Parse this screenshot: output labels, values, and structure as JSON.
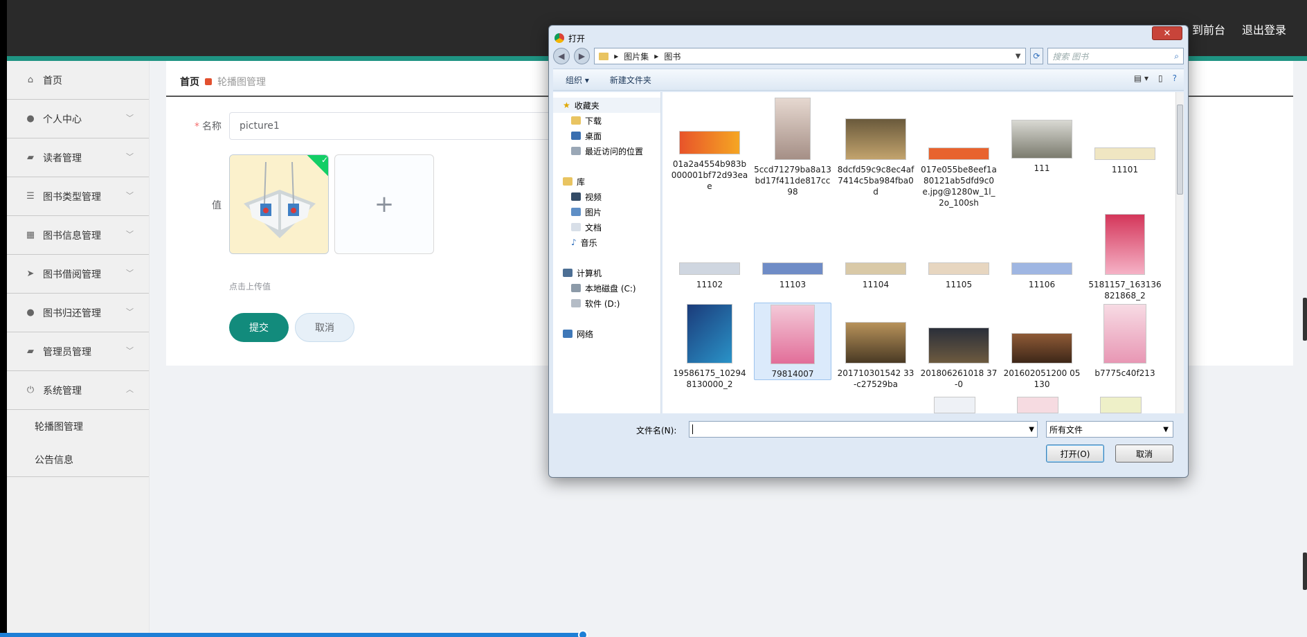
{
  "header": {
    "to_frontend": "到前台",
    "logout": "退出登录"
  },
  "sidebar": {
    "items": [
      {
        "label": "首页",
        "icon": "home-icon"
      },
      {
        "label": "个人中心",
        "icon": "user-icon"
      },
      {
        "label": "读者管理",
        "icon": "briefcase-icon"
      },
      {
        "label": "图书类型管理",
        "icon": "sliders-icon"
      },
      {
        "label": "图书信息管理",
        "icon": "grid-icon"
      },
      {
        "label": "图书借阅管理",
        "icon": "send-icon"
      },
      {
        "label": "图书归还管理",
        "icon": "user-icon"
      },
      {
        "label": "管理员管理",
        "icon": "briefcase-icon"
      },
      {
        "label": "系统管理",
        "icon": "power-icon"
      }
    ],
    "sub_items": [
      "轮播图管理",
      "公告信息"
    ]
  },
  "breadcrumb": {
    "home": "首页",
    "current": "轮播图管理"
  },
  "form": {
    "name_label": "名称",
    "name_value": "picture1",
    "value_label": "值",
    "upload_hint": "点击上传值",
    "submit": "提交",
    "cancel": "取消"
  },
  "dialog": {
    "title": "打开",
    "path": [
      "图片集",
      "图书"
    ],
    "search_placeholder": "搜索 图书",
    "toolbar": {
      "organize": "组织 ▾",
      "new_folder": "新建文件夹"
    },
    "nav": {
      "favorites": "收藏夹",
      "downloads": "下载",
      "desktop": "桌面",
      "recent": "最近访问的位置",
      "library": "库",
      "videos": "视频",
      "pictures": "图片",
      "documents": "文档",
      "music": "音乐",
      "computer": "计算机",
      "disk_c": "本地磁盘 (C:)",
      "disk_d": "软件 (D:)",
      "network": "网络"
    },
    "files": [
      "01a2a4554b983b000001bf72d93eae",
      "5ccd71279ba8a13bd17f411de817cc98",
      "8dcfd59c9c8ec4af7414c5ba984fba0d",
      "017e055be8eef1a80121ab5dfd9c0e.jpg@1280w_1l_2o_100sh",
      "111",
      "11101",
      "11102",
      "11103",
      "11104",
      "11105",
      "11106",
      "5181157_163136821868_2",
      "19586175_102948130000_2",
      "79814007",
      "201710301542 33-c27529ba",
      "201806261018 37-0",
      "201602051200 05130",
      "b7775c40f213"
    ],
    "filename_label": "文件名(N):",
    "filename_value": "",
    "filetype": "所有文件",
    "open_button": "打开(O)",
    "cancel_button": "取消"
  }
}
